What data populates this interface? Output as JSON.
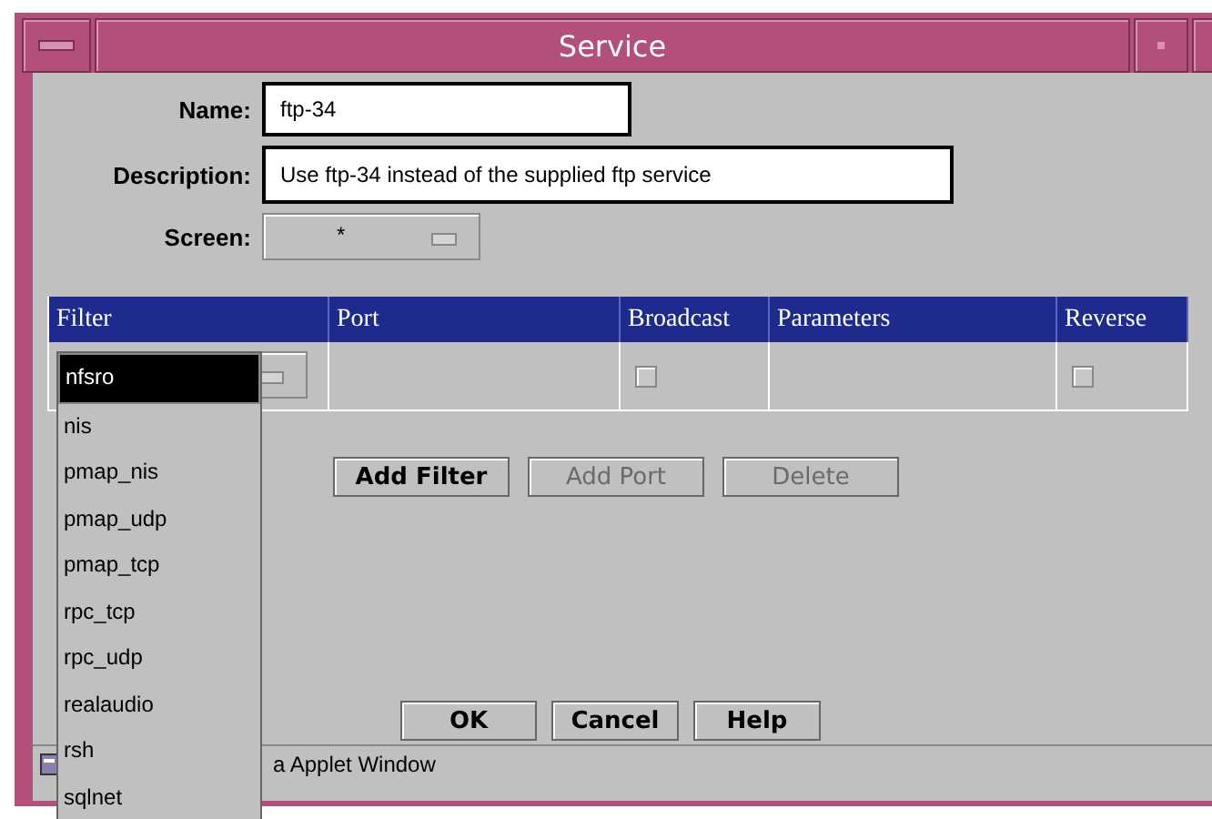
{
  "window": {
    "title": "Service"
  },
  "fields": [
    {
      "label": "Name:",
      "value": "ftp-34"
    },
    {
      "label": "Description:",
      "value": "Use ftp-34 instead of the supplied ftp service"
    }
  ],
  "screen": {
    "label": "Screen:",
    "value": "*"
  },
  "table": {
    "columns": [
      "Filter",
      "Port",
      "Broadcast",
      "Parameters",
      "Reverse"
    ],
    "rows": [
      {
        "broadcast": false,
        "reverse": false
      }
    ]
  },
  "filter_list": [
    {
      "label": "nfsro",
      "selected": true
    },
    {
      "label": "nis",
      "selected": false
    },
    {
      "label": "pmap_nis",
      "selected": false
    },
    {
      "label": "pmap_udp",
      "selected": false
    },
    {
      "label": "pmap_tcp",
      "selected": false
    },
    {
      "label": "rpc_tcp",
      "selected": false
    },
    {
      "label": "rpc_udp",
      "selected": false
    },
    {
      "label": "realaudio",
      "selected": false
    },
    {
      "label": "rsh",
      "selected": false
    },
    {
      "label": "sqlnet",
      "selected": false
    }
  ],
  "action_buttons": [
    {
      "label": "Add Filter",
      "disabled": false
    },
    {
      "label": "Add Port",
      "disabled": true
    },
    {
      "label": "Delete",
      "disabled": true
    }
  ],
  "dialog_buttons": [
    "OK",
    "Cancel",
    "Help"
  ],
  "status_bar": "a Applet Window"
}
